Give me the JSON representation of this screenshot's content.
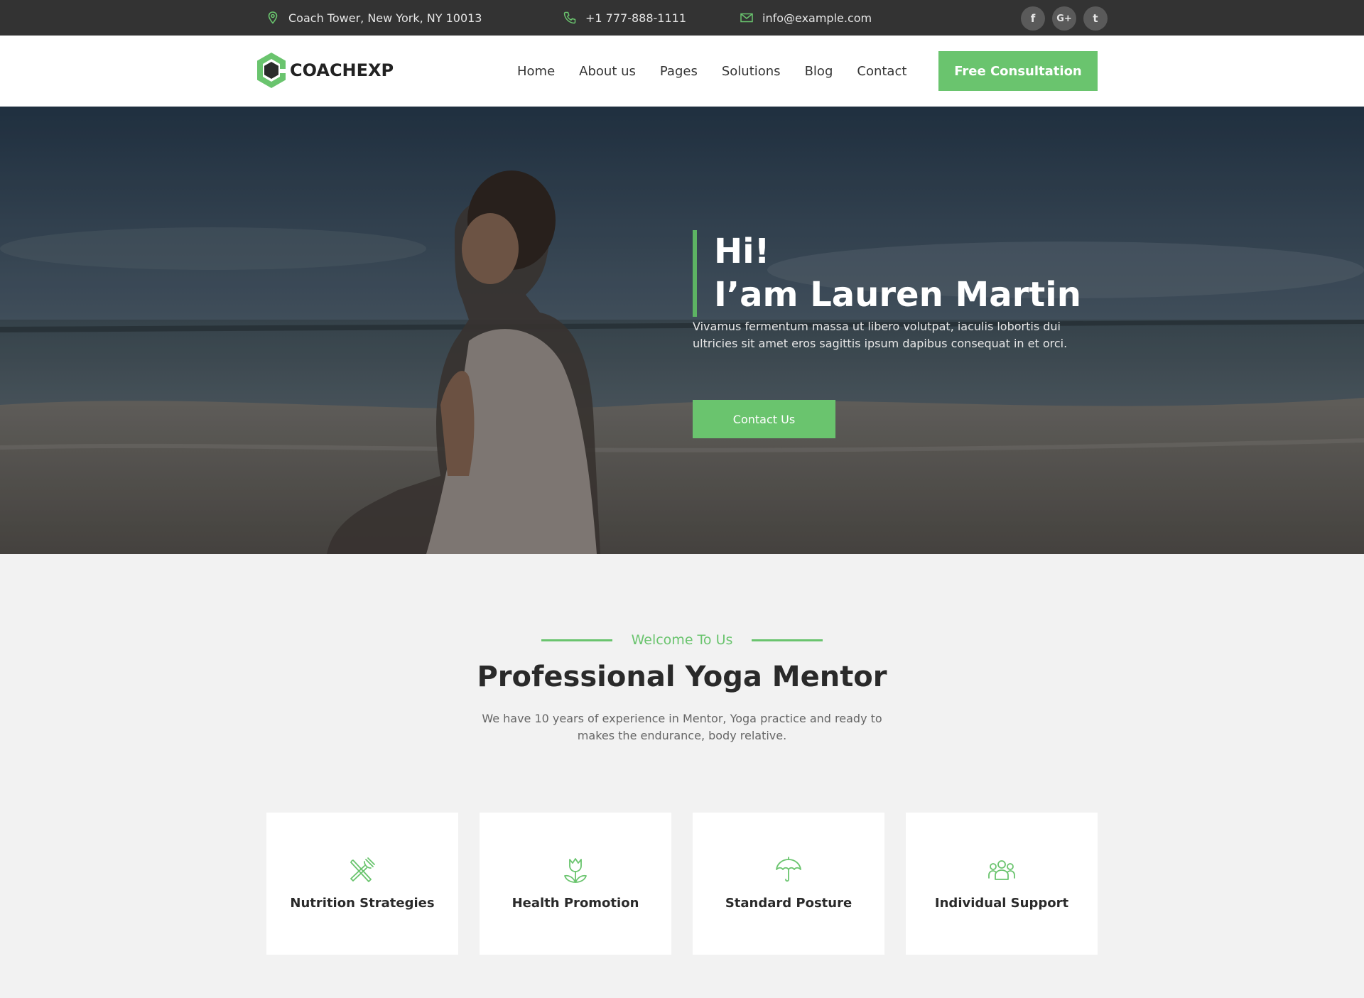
{
  "topbar": {
    "address": "Coach Tower, New York, NY 10013",
    "phone": "+1 777-888-1111",
    "email": "info@example.com",
    "social": [
      "f",
      "G+",
      "t"
    ]
  },
  "header": {
    "logo_text": "COACHEXP",
    "nav": [
      "Home",
      "About us",
      "Pages",
      "Solutions",
      "Blog",
      "Contact"
    ],
    "cta_label": "Free Consultation"
  },
  "hero": {
    "title_line1": "Hi!",
    "title_line2": "I’am Lauren Martin",
    "description": "Vivamus fermentum massa ut libero volutpat, iaculis lobortis dui ultricies sit amet eros sagittis ipsum dapibus consequat in et orci.",
    "button_label": "Contact Us"
  },
  "welcome": {
    "kicker": "Welcome To Us",
    "title": "Professional Yoga Mentor",
    "description": "We have 10 years of experience in Mentor, Yoga practice and ready to makes the endurance, body relative."
  },
  "features": [
    {
      "label": "Nutrition Strategies",
      "icon": "utensils-icon"
    },
    {
      "label": "Health Promotion",
      "icon": "tulip-icon"
    },
    {
      "label": "Standard Posture",
      "icon": "umbrella-icon"
    },
    {
      "label": "Individual Support",
      "icon": "people-icon"
    }
  ],
  "colors": {
    "accent": "#6ac46e",
    "topbar_bg": "#333333",
    "page_bg": "#f2f2f2"
  }
}
